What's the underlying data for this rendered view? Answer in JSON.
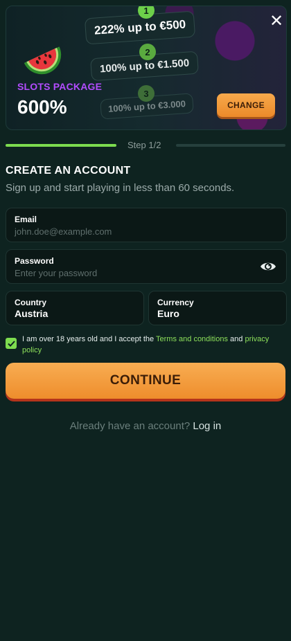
{
  "banner": {
    "package_label": "SLOTS PACKAGE",
    "package_value": "600%",
    "tiers": [
      {
        "num": "1",
        "text": "222% up to €500"
      },
      {
        "num": "2",
        "text": "100% up to €1.500"
      },
      {
        "num": "3",
        "text": "100% up to €3.000"
      }
    ],
    "change_label": "CHANGE",
    "close_icon": "✕"
  },
  "progress": {
    "step_text": "Step 1/2",
    "fraction": 0.5
  },
  "form": {
    "title": "CREATE AN ACCOUNT",
    "subtitle": "Sign up and start playing in less than 60 seconds.",
    "email": {
      "label": "Email",
      "placeholder": "john.doe@example.com"
    },
    "password": {
      "label": "Password",
      "placeholder": "Enter your password"
    },
    "country": {
      "label": "Country",
      "value": "Austria"
    },
    "currency": {
      "label": "Currency",
      "value": "Euro"
    },
    "terms": {
      "text_1": "I am over 18 years old and I accept the ",
      "link_1": "Terms and conditions",
      "text_2": " and ",
      "link_2": "privacy policy",
      "checked": true
    },
    "continue_label": "CONTINUE"
  },
  "login": {
    "prompt": "Already have an account?",
    "link": "Log in"
  },
  "colors": {
    "background": "#0e2320",
    "accent_green": "#7ddc4f",
    "button_orange": "#f29a3a",
    "package_purple": "#b34cff"
  }
}
